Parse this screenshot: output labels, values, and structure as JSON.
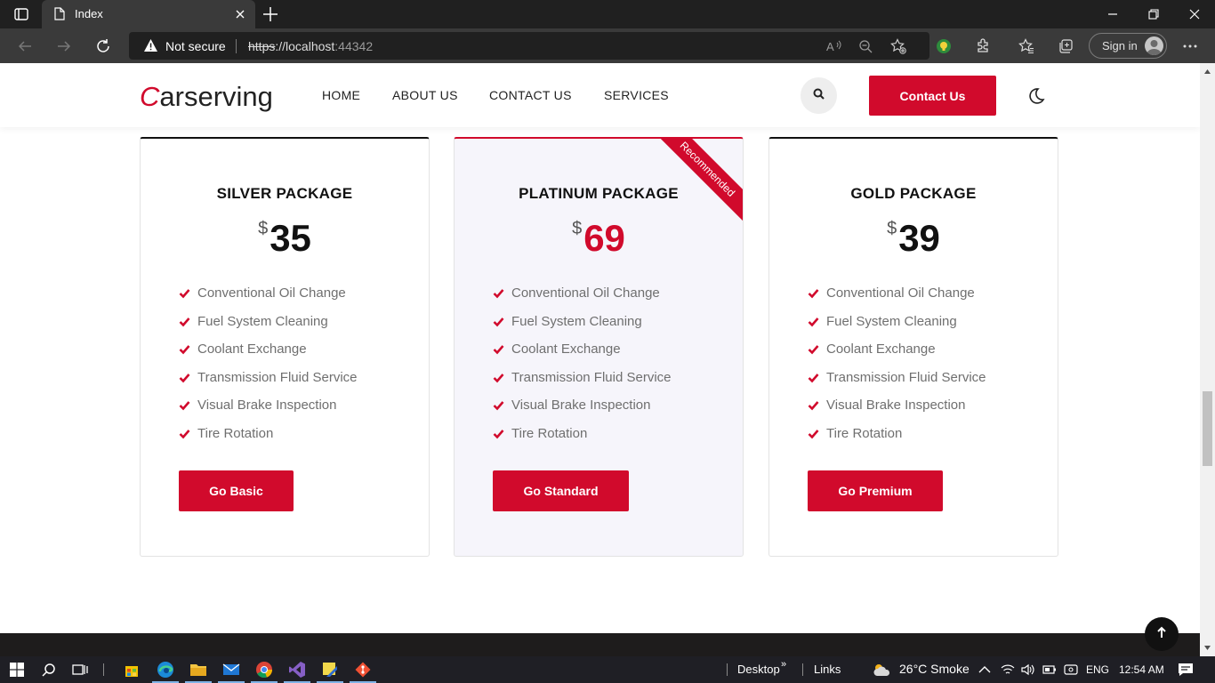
{
  "browser": {
    "tab_title": "Index",
    "security_label": "Not secure",
    "url_scheme": "https",
    "url_host": "://localhost",
    "url_port": ":44342",
    "signin_label": "Sign in"
  },
  "site": {
    "logo_first": "C",
    "logo_rest": "arserving",
    "nav": [
      "HOME",
      "ABOUT US",
      "CONTACT US",
      "SERVICES"
    ],
    "contact_button": "Contact Us"
  },
  "packages": [
    {
      "title": "SILVER PACKAGE",
      "currency": "$",
      "price": "35",
      "features": [
        "Conventional Oil Change",
        "Fuel System Cleaning",
        "Coolant Exchange",
        "Transmission Fluid Service",
        "Visual Brake Inspection",
        "Tire Rotation"
      ],
      "button": "Go Basic"
    },
    {
      "title": "PLATINUM PACKAGE",
      "currency": "$",
      "price": "69",
      "ribbon": "Recommended",
      "features": [
        "Conventional Oil Change",
        "Fuel System Cleaning",
        "Coolant Exchange",
        "Transmission Fluid Service",
        "Visual Brake Inspection",
        "Tire Rotation"
      ],
      "button": "Go Standard"
    },
    {
      "title": "GOLD PACKAGE",
      "currency": "$",
      "price": "39",
      "features": [
        "Conventional Oil Change",
        "Fuel System Cleaning",
        "Coolant Exchange",
        "Transmission Fluid Service",
        "Visual Brake Inspection",
        "Tire Rotation"
      ],
      "button": "Go Premium"
    }
  ],
  "taskbar": {
    "desktop_label": "Desktop",
    "links_label": "Links",
    "weather": "26°C  Smoke",
    "lang": "ENG",
    "time": "12:54 AM"
  },
  "colors": {
    "accent": "#d10a2c",
    "dark": "#111111",
    "featured_bg": "#f6f5fb"
  }
}
